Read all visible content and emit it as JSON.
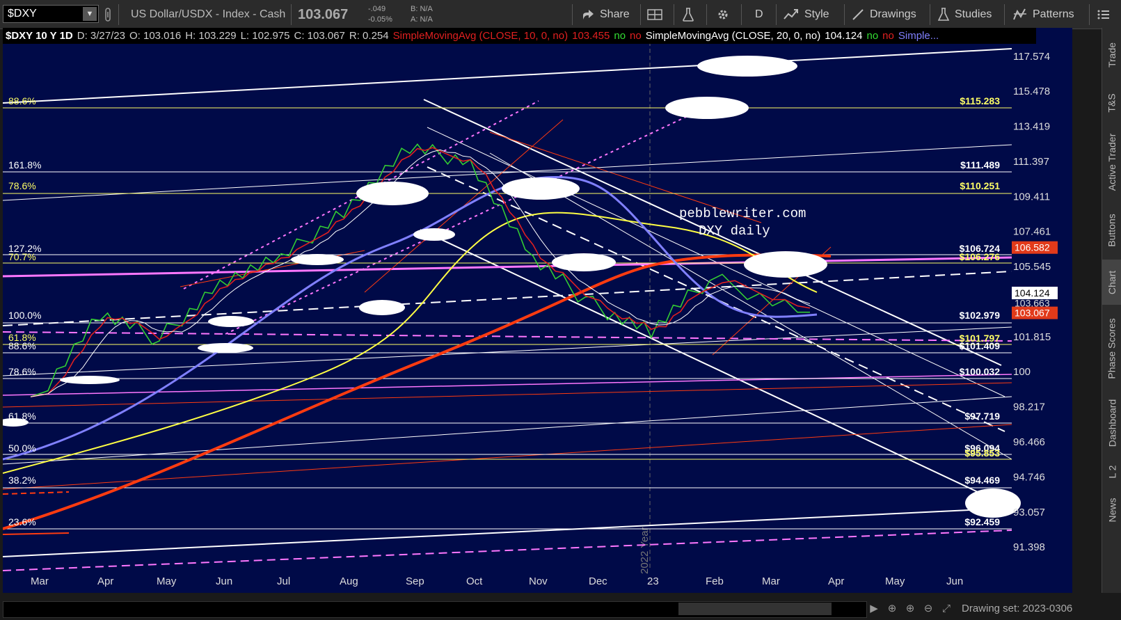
{
  "toolbar": {
    "symbol": "$DXY",
    "description": "US Dollar/USDX - Index - Cash",
    "last_price": "103.067",
    "change": "-.049",
    "change_pct": "-0.05%",
    "bid": "B: N/A",
    "ask": "A: N/A",
    "share": "Share",
    "aggregation": "D",
    "style": "Style",
    "drawings": "Drawings",
    "studies": "Studies",
    "patterns": "Patterns"
  },
  "infobar": {
    "title": "$DXY 10 Y 1D",
    "date": "D: 3/27/23",
    "open": "O: 103.016",
    "high": "H: 103.229",
    "low": "L: 102.975",
    "close": "C: 103.067",
    "range": "R: 0.254",
    "sma1_label": "SimpleMovingAvg (CLOSE, 10, 0, no)",
    "sma1_value": "103.455",
    "sma2_label": "SimpleMovingAvg (CLOSE, 20, 0, no)",
    "sma2_value": "104.124",
    "no": "no",
    "sma_more": "Simple..."
  },
  "chart_data": {
    "type": "line",
    "ylim": [
      90.3,
      119.3
    ],
    "price_axis_ticks": [
      "117.574",
      "115.478",
      "113.419",
      "111.397",
      "109.411",
      "107.461",
      "105.545",
      "101.815",
      "100",
      "98.217",
      "96.466",
      "94.746",
      "93.057",
      "91.398"
    ],
    "price_tags": [
      {
        "label": "106.582",
        "color": "#e23a1a"
      },
      {
        "label": "104.124",
        "color": "#ffffff"
      },
      {
        "label": "103.663",
        "color": "#8080ff"
      },
      {
        "label": "103.067",
        "color": "#e23a1a"
      }
    ],
    "x_months": [
      "Mar",
      "Apr",
      "May",
      "Jun",
      "Jul",
      "Aug",
      "Sep",
      "Oct",
      "Nov",
      "Dec",
      "23",
      "Feb",
      "Mar",
      "Apr",
      "May",
      "Jun"
    ],
    "year_marker": "2022 Year",
    "fib_left": [
      "88.6%",
      "161.8%",
      "78.6%",
      "127.2%",
      "70.7%",
      "100.0%",
      "61.8%",
      "88.6%",
      "78.6%",
      "61.8%",
      "50.0%",
      "38.2%",
      "23.6%"
    ],
    "fib_right": [
      "$115.283",
      "$111.489",
      "$110.251",
      "$106.724",
      "$106.276",
      "$102.979",
      "$101.797",
      "$101.409",
      "$100.032",
      "$97.719",
      "$96.094",
      "$95.853",
      "$94.469",
      "$92.459"
    ],
    "annotation": [
      "pebblewriter.com",
      "DXY daily"
    ],
    "close_series": [
      {
        "x": "2022-03",
        "y": 98.3
      },
      {
        "x": "2022-04",
        "y": 103.0
      },
      {
        "x": "2022-05",
        "y": 101.7
      },
      {
        "x": "2022-06",
        "y": 104.7
      },
      {
        "x": "2022-07",
        "y": 105.9
      },
      {
        "x": "2022-08",
        "y": 108.7
      },
      {
        "x": "2022-09",
        "y": 112.1
      },
      {
        "x": "2022-10",
        "y": 111.5
      },
      {
        "x": "2022-11",
        "y": 105.9
      },
      {
        "x": "2022-12",
        "y": 103.5
      },
      {
        "x": "2023-01",
        "y": 102.1
      },
      {
        "x": "2023-02",
        "y": 104.9
      },
      {
        "x": "2023-03",
        "y": 103.1
      }
    ],
    "series": [
      {
        "name": "SimpleMovingAvg (CLOSE, 10, 0, no)",
        "color": "#e02020"
      },
      {
        "name": "SimpleMovingAvg (CLOSE, 20, 0, no)",
        "color": "#ffffff"
      }
    ]
  },
  "sidetabs": [
    "Trade",
    "T&S",
    "Active Trader",
    "Buttons",
    "Chart",
    "Phase Scores",
    "Dashboard",
    "L 2",
    "News"
  ],
  "bottom": {
    "drawing_set": "Drawing set: 2023-0306"
  },
  "colors": {
    "chart_bg": "#000a48",
    "fib_yellow": "#ffff66",
    "fib_white": "#ffffff",
    "magenta": "#ff77ff",
    "orange": "#ff3b10"
  }
}
